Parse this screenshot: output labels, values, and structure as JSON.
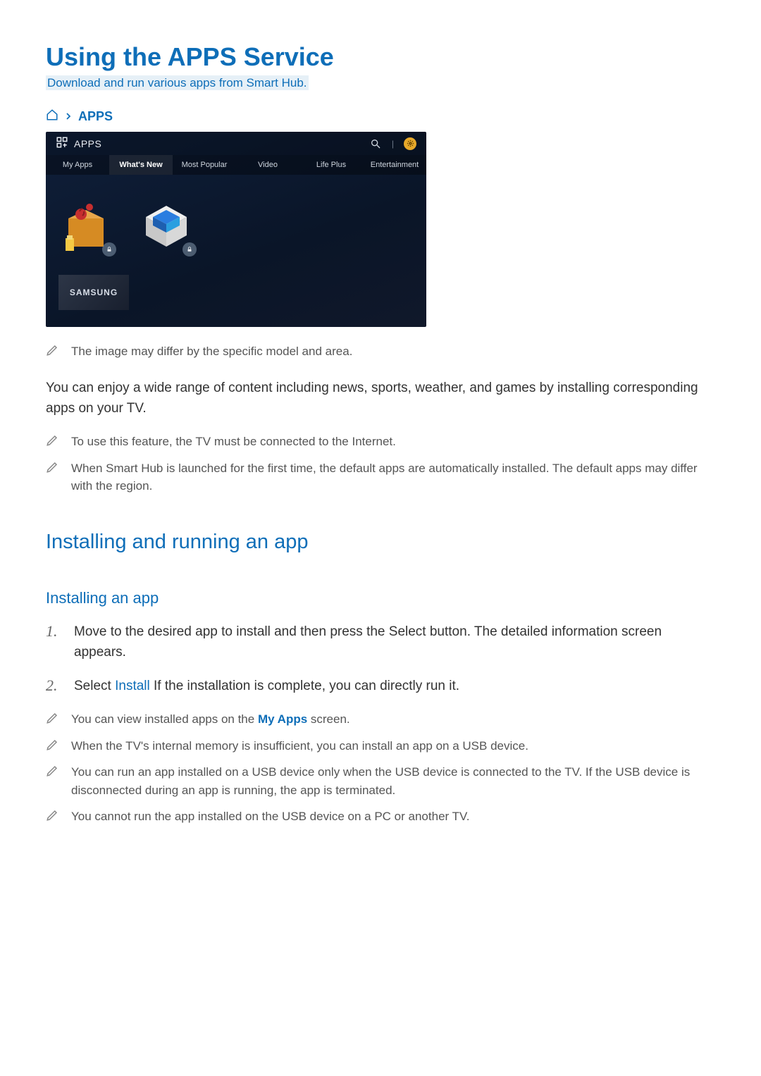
{
  "page": {
    "title": "Using the APPS Service",
    "subtitle": "Download and run various apps from Smart Hub."
  },
  "breadcrumb": {
    "label": "APPS"
  },
  "tv": {
    "header_label": "APPS",
    "tabs": [
      "My Apps",
      "What's New",
      "Most Popular",
      "Video",
      "Life Plus",
      "Entertainment"
    ],
    "active_tab_index": 1,
    "brand": "SAMSUNG"
  },
  "notes": {
    "image_differs": "The image may differ by the specific model and area.",
    "body_intro": "You can enjoy a wide range of content including news, sports, weather, and games by installing corresponding apps on your TV.",
    "internet_required": "To use this feature, the TV must be connected to the Internet.",
    "default_apps": "When Smart Hub is launched for the first time, the default apps are automatically installed. The default apps may differ with the region."
  },
  "section2": {
    "title": "Installing and running an app",
    "subtitle": "Installing an app",
    "steps": [
      {
        "num": "1.",
        "text": "Move to the desired app to install and then press the Select button. The detailed information screen appears."
      },
      {
        "num": "2.",
        "prefix": "Select ",
        "link": "Install",
        "suffix": " If the installation is complete, you can directly run it."
      }
    ],
    "notes": [
      {
        "prefix": "You can view installed apps on the ",
        "link": "My Apps",
        "suffix": " screen."
      },
      {
        "text": "When the TV's internal memory is insufficient, you can install an app on a USB device."
      },
      {
        "text": "You can run an app installed on a USB device only when the USB device is connected to the TV. If the USB device is disconnected during an app is running, the app is terminated."
      },
      {
        "text": "You cannot run the app installed on the USB device on a PC or another TV."
      }
    ]
  }
}
